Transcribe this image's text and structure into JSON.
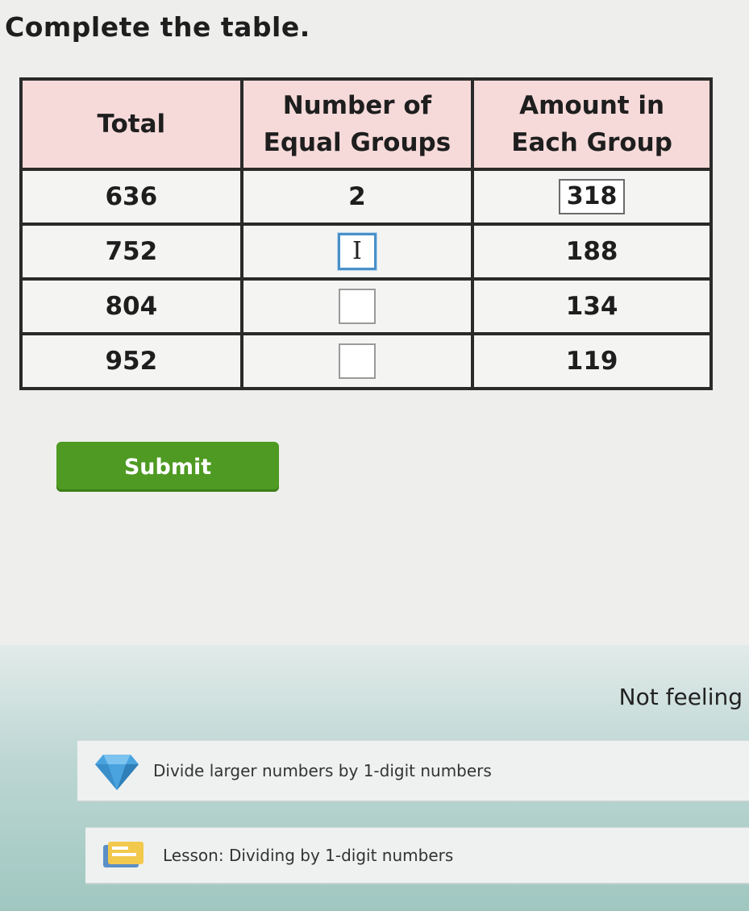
{
  "instruction": "Complete the table.",
  "table": {
    "headers": {
      "total": "Total",
      "groups_line1": "Number of",
      "groups_line2": "Equal Groups",
      "amount_line1": "Amount in",
      "amount_line2": "Each Group"
    },
    "rows": [
      {
        "total": "636",
        "groups": "2",
        "amount": "318"
      },
      {
        "total": "752",
        "groups": "",
        "amount": "188"
      },
      {
        "total": "804",
        "groups": "",
        "amount": "134"
      },
      {
        "total": "952",
        "groups": "",
        "amount": "119"
      }
    ]
  },
  "submit_label": "Submit",
  "feeling_text": "Not feeling",
  "recommendations": {
    "skill_label": "Divide larger numbers by 1-digit numbers",
    "lesson_label": "Lesson: Dividing by 1-digit numbers"
  },
  "colors": {
    "header_bg": "#f6dad9",
    "submit_bg": "#4e9a22",
    "active_input_border": "#4a90c8",
    "diamond_icon": "#4aa3df"
  },
  "icons": {
    "text_cursor": "I",
    "skill_icon": "diamond-icon",
    "lesson_icon": "lesson-icon"
  }
}
